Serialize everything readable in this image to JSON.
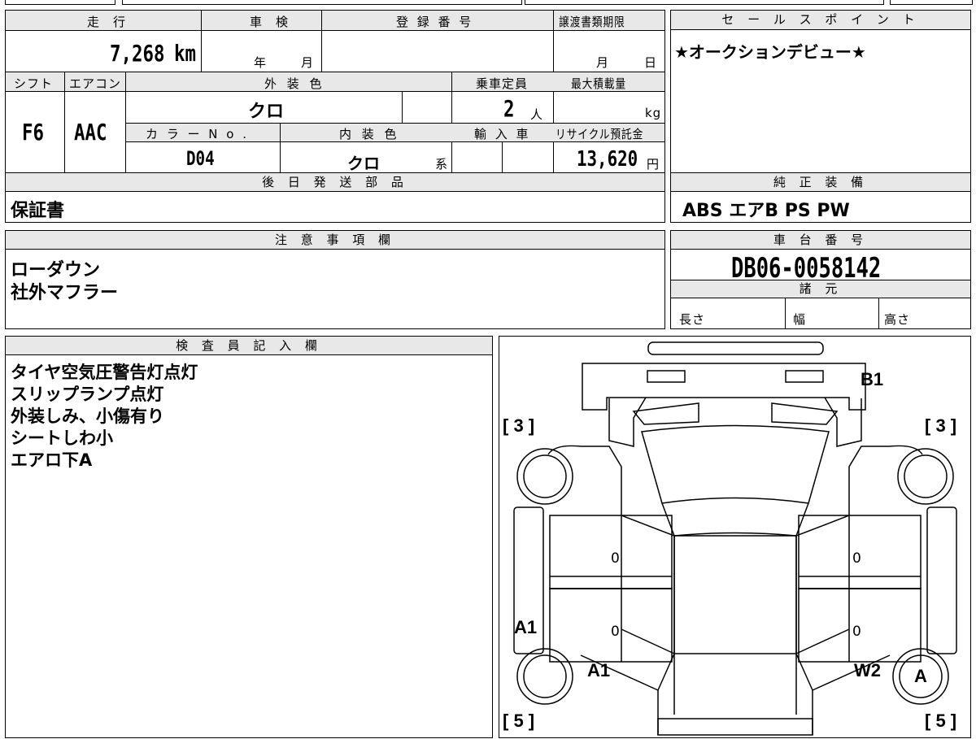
{
  "vehicle": {
    "mileage_label": "走　行",
    "mileage": "7,268",
    "mileage_unit": "km",
    "inspection_label": "車　検",
    "inspection_year": "年",
    "inspection_month": "月",
    "registration_label": "登 録 番 号",
    "transfer_label": "譲渡書類期限",
    "transfer_month": "月",
    "transfer_day": "日",
    "shift_label": "シフト",
    "shift": "F6",
    "ac_label": "エアコン",
    "ac": "AAC",
    "ext_color_label": "外 装 色",
    "ext_color": "クロ",
    "capacity_label": "乗車定員",
    "capacity": "2",
    "capacity_unit": "人",
    "max_load_label": "最大積載量",
    "max_load_unit": "kg",
    "color_no_label": "カ ラ ー N o .",
    "color_no": "D04",
    "int_color_label": "内 装 色",
    "int_color": "クロ",
    "int_color_suffix": "系",
    "import_label": "輸 入 車",
    "recycle_label": "リサイクル預託金",
    "recycle_fee": "13,620",
    "recycle_unit": "円"
  },
  "later_parts": {
    "header": "後 日 発 送 部 品",
    "value": "保証書"
  },
  "sales_point": {
    "header": "セ ー ル ス ポ イ ン ト",
    "value": "★オークションデビュー★"
  },
  "genuine_equipment": {
    "header": "純 正 装 備",
    "value": "ABS エアB PS PW"
  },
  "notes": {
    "header": "注 意 事 項 欄",
    "lines": [
      "ローダウン",
      "社外マフラー"
    ]
  },
  "chassis": {
    "header": "車 台 番 号",
    "value": "DB06-0058142"
  },
  "specs": {
    "header": "諸 元",
    "length": "長さ",
    "width": "幅",
    "height": "高さ"
  },
  "inspector": {
    "header": "検 査 員 記 入 欄",
    "lines": [
      "タイヤ空気圧警告灯点灯",
      "スリップランプ点灯",
      "外装しみ、小傷有り",
      "シートしわ小",
      "エアロ下A"
    ]
  },
  "diagram": {
    "top_left_tire": "[ 3 ]",
    "top_right_tire": "[ 3 ]",
    "bottom_left_tire": "[ 5 ]",
    "bottom_right_tire": "[ 5 ]",
    "mark_b1": "B1",
    "mark_a1_side": "A1",
    "mark_a1_rear": "A1",
    "mark_w2": "W2",
    "mark_a_circle": "A",
    "door_fl": "0",
    "door_fr": "0",
    "door_rl": "0",
    "door_rr": "0"
  }
}
